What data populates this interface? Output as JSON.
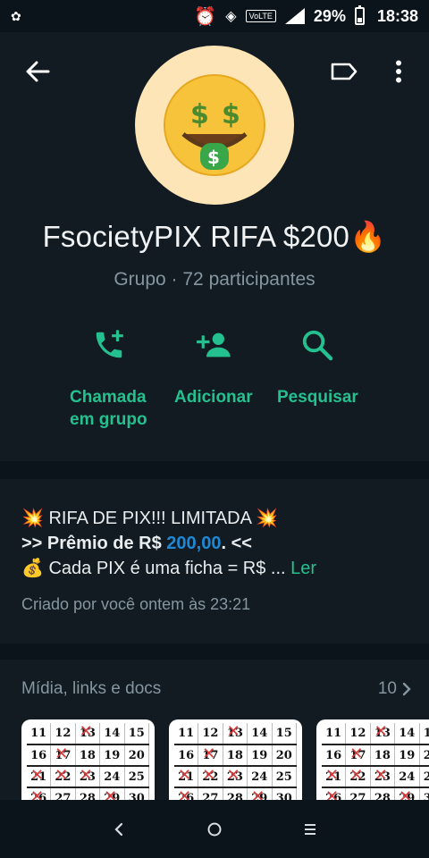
{
  "status_bar": {
    "left_icon": "notification-icon",
    "battery_percent": "29%",
    "time": "18:38",
    "volte_label": "VoLTE"
  },
  "header": {
    "avatar_emoji": "🤑",
    "group_name": "FsocietyPIX RIFA $200🔥",
    "subtitle": "Grupo · 72 participantes",
    "actions": [
      {
        "icon": "add-call-icon",
        "label_line1": "Chamada",
        "label_line2": "em grupo"
      },
      {
        "icon": "add-person-icon",
        "label": "Adicionar"
      },
      {
        "icon": "search-icon",
        "label": "Pesquisar"
      }
    ]
  },
  "description": {
    "line1": "💥 RIFA DE PIX!!! LIMITADA 💥",
    "line2_prefix": ">> Prêmio de R$ ",
    "line2_amount": "200,00",
    "line2_suffix": ". <<",
    "line3": "💰 Cada PIX é uma ficha = R$ ... ",
    "read_more": "Ler",
    "created": "Criado por você ontem às 23:21"
  },
  "media": {
    "title": "Mídia, links e docs",
    "count": "10",
    "grid_rows": [
      [
        "11",
        "12",
        "13",
        "14",
        "15"
      ],
      [
        "16",
        "17",
        "18",
        "19",
        "20"
      ],
      [
        "21",
        "22",
        "23",
        "24",
        "25"
      ],
      [
        "26",
        "27",
        "28",
        "29",
        "30"
      ]
    ]
  },
  "colors": {
    "accent": "#25c08f",
    "background": "#0b141a",
    "card": "#111b21",
    "muted": "#8696a0",
    "link_blue": "#1e88d6"
  }
}
